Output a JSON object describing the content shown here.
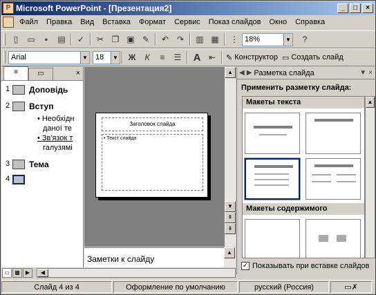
{
  "window": {
    "title": "Microsoft PowerPoint - [Презентация2]",
    "min": "_",
    "max": "□",
    "close": "×"
  },
  "menu": [
    "Файл",
    "Правка",
    "Вид",
    "Вставка",
    "Формат",
    "Сервис",
    "Показ слайдов",
    "Окно",
    "Справка"
  ],
  "toolbar1": {
    "zoom": "18%",
    "help": "?"
  },
  "toolbar2": {
    "font": "Arial",
    "size": "18",
    "bold": "Ж",
    "italic": "К",
    "designer": "Конструктор",
    "new_slide": "Создать слайд",
    "font_grow": "A"
  },
  "outline": {
    "slides": [
      {
        "num": "1",
        "title": "Доповідь"
      },
      {
        "num": "2",
        "title": "Вступ",
        "bullets": [
          "• Необхідн",
          "даної те",
          "• Зв'язок т",
          "галузямі"
        ]
      },
      {
        "num": "3",
        "title": "Тема"
      },
      {
        "num": "4",
        "title": ""
      }
    ]
  },
  "slide": {
    "title": "Заголовок слайда",
    "body": "• Текст слайда"
  },
  "notes": {
    "placeholder": "Заметки к слайду"
  },
  "taskpane": {
    "title": "Разметка слайда",
    "apply": "Применить разметку слайда:",
    "section_text": "Макеты текста",
    "section_content": "Макеты содержимого",
    "show_on_insert": "Показывать при вставке слайдов"
  },
  "status": {
    "slide": "Слайд 4 из 4",
    "design": "Оформление по умолчанию",
    "lang": "русский (Россия)"
  },
  "colors": {
    "title_start": "#0a246a",
    "title_end": "#a6caf0",
    "chrome": "#d4d0c8",
    "work": "#808080"
  }
}
